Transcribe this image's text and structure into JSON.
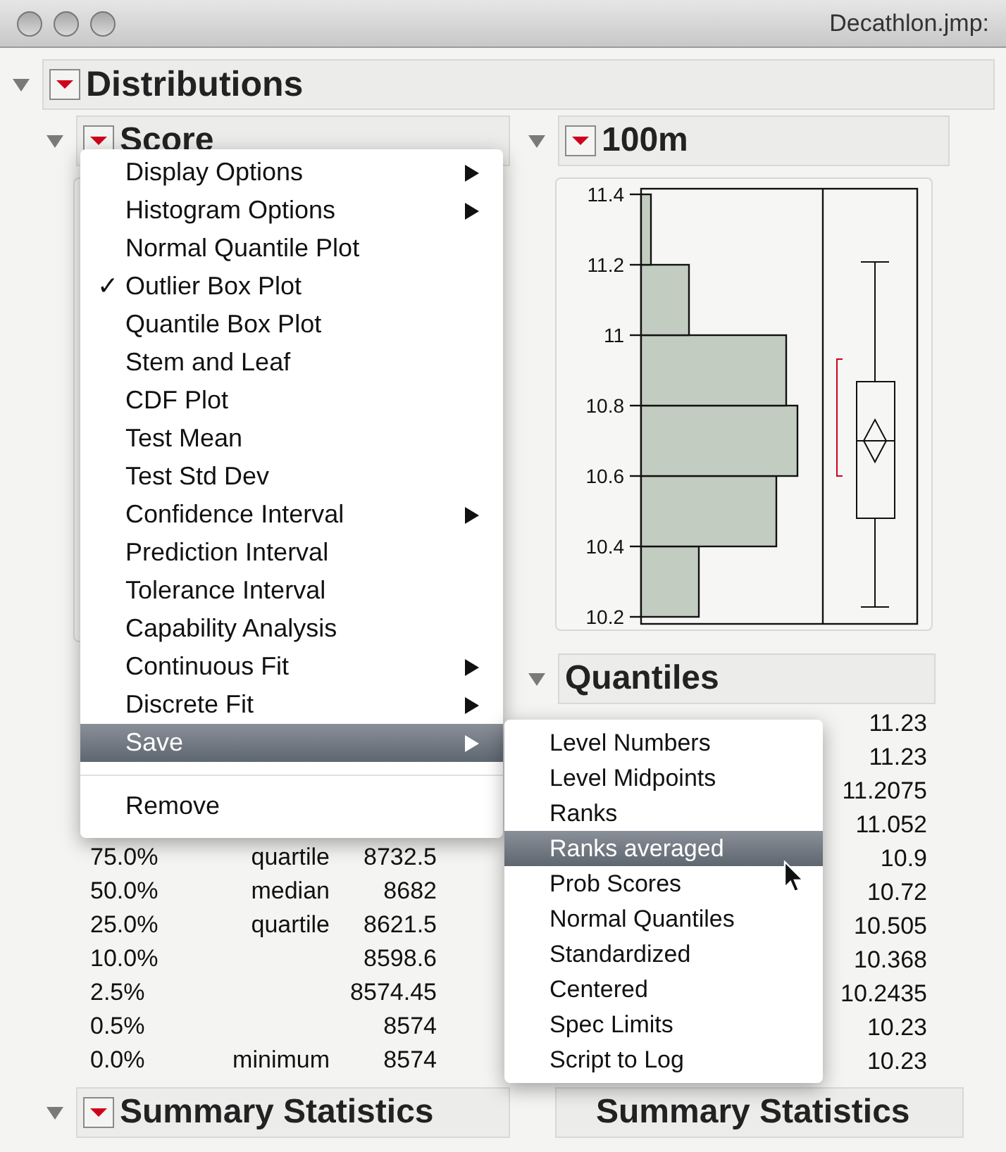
{
  "window": {
    "title": "Decathlon.jmp:"
  },
  "report": {
    "title": "Distributions",
    "expanded": true
  },
  "left": {
    "title": "Score",
    "expanded": true,
    "quantiles": [
      {
        "pct": "75.0%",
        "label": "quartile",
        "value": "8732.5"
      },
      {
        "pct": "50.0%",
        "label": "median",
        "value": "8682"
      },
      {
        "pct": "25.0%",
        "label": "quartile",
        "value": "8621.5"
      },
      {
        "pct": "10.0%",
        "value": "8598.6"
      },
      {
        "pct": "2.5%",
        "value": "8574.45"
      },
      {
        "pct": "0.5%",
        "value": "8574"
      },
      {
        "pct": "0.0%",
        "label": "minimum",
        "value": "8574"
      }
    ],
    "summary": {
      "title": "Summary Statistics",
      "expanded": true
    }
  },
  "right": {
    "title": "100m",
    "expanded": true,
    "axis_ticks": [
      "11.4",
      "11.2",
      "11",
      "10.8",
      "10.6",
      "10.4",
      "10.2"
    ],
    "quantiles": {
      "title": "Quantiles",
      "expanded": true,
      "values": [
        "11.23",
        "11.23",
        "11.2075",
        "11.052",
        "10.9",
        "10.72",
        "10.505",
        "10.368",
        "10.2435",
        "10.23",
        "10.23"
      ]
    },
    "summary": {
      "title": "Summary Statistics"
    }
  },
  "menu": {
    "groups": [
      [
        {
          "label": "Display Options",
          "checked": false,
          "submenu": true,
          "selected": false
        },
        {
          "label": "Histogram Options",
          "checked": false,
          "submenu": true,
          "selected": false
        },
        {
          "label": "Normal Quantile Plot",
          "checked": false,
          "submenu": false,
          "selected": false
        },
        {
          "label": "Outlier Box Plot",
          "checked": true,
          "submenu": false,
          "selected": false
        },
        {
          "label": "Quantile Box Plot",
          "checked": false,
          "submenu": false,
          "selected": false
        },
        {
          "label": "Stem and Leaf",
          "checked": false,
          "submenu": false,
          "selected": false
        },
        {
          "label": "CDF Plot",
          "checked": false,
          "submenu": false,
          "selected": false
        },
        {
          "label": "Test Mean",
          "checked": false,
          "submenu": false,
          "selected": false
        },
        {
          "label": "Test Std Dev",
          "checked": false,
          "submenu": false,
          "selected": false
        },
        {
          "label": "Confidence Interval",
          "checked": false,
          "submenu": true,
          "selected": false
        },
        {
          "label": "Prediction Interval",
          "checked": false,
          "submenu": false,
          "selected": false
        },
        {
          "label": "Tolerance Interval",
          "checked": false,
          "submenu": false,
          "selected": false
        },
        {
          "label": "Capability Analysis",
          "checked": false,
          "submenu": false,
          "selected": false
        },
        {
          "label": "Continuous Fit",
          "checked": false,
          "submenu": true,
          "selected": false
        },
        {
          "label": "Discrete Fit",
          "checked": false,
          "submenu": true,
          "selected": false
        },
        {
          "label": "Save",
          "checked": false,
          "submenu": true,
          "selected": true
        }
      ],
      [
        {
          "label": "Remove",
          "checked": false,
          "submenu": false,
          "selected": false
        }
      ]
    ],
    "check_mark": "✓"
  },
  "submenu": {
    "items": [
      {
        "label": "Level Numbers",
        "selected": false
      },
      {
        "label": "Level Midpoints",
        "selected": false
      },
      {
        "label": "Ranks",
        "selected": false
      },
      {
        "label": "Ranks averaged",
        "selected": true
      },
      {
        "label": "Prob Scores",
        "selected": false
      },
      {
        "label": "Normal Quantiles",
        "selected": false
      },
      {
        "label": "Standardized",
        "selected": false
      },
      {
        "label": "Centered",
        "selected": false
      },
      {
        "label": "Spec Limits",
        "selected": false
      },
      {
        "label": "Script to Log",
        "selected": false
      }
    ]
  }
}
